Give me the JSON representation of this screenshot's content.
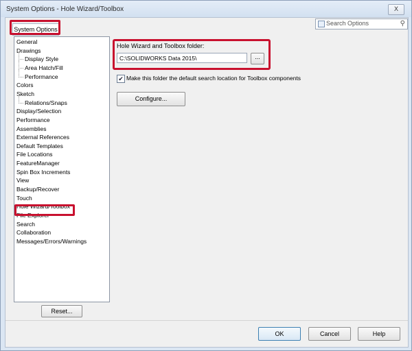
{
  "window": {
    "title": "System Options - Hole Wizard/Toolbox",
    "close_label": "X"
  },
  "tab": {
    "label": "System Options"
  },
  "search": {
    "placeholder": "Search Options"
  },
  "tree": {
    "items": [
      {
        "label": "General",
        "indent": 0
      },
      {
        "label": "Drawings",
        "indent": 0
      },
      {
        "label": "Display Style",
        "indent": 1
      },
      {
        "label": "Area Hatch/Fill",
        "indent": 1
      },
      {
        "label": "Performance",
        "indent": 1
      },
      {
        "label": "Colors",
        "indent": 0
      },
      {
        "label": "Sketch",
        "indent": 0
      },
      {
        "label": "Relations/Snaps",
        "indent": 1
      },
      {
        "label": "Display/Selection",
        "indent": 0
      },
      {
        "label": "Performance",
        "indent": 0
      },
      {
        "label": "Assemblies",
        "indent": 0
      },
      {
        "label": "External References",
        "indent": 0
      },
      {
        "label": "Default Templates",
        "indent": 0
      },
      {
        "label": "File Locations",
        "indent": 0
      },
      {
        "label": "FeatureManager",
        "indent": 0
      },
      {
        "label": "Spin Box Increments",
        "indent": 0
      },
      {
        "label": "View",
        "indent": 0
      },
      {
        "label": "Backup/Recover",
        "indent": 0
      },
      {
        "label": "Touch",
        "indent": 0
      },
      {
        "label": "Hole Wizard/Toolbox",
        "indent": 0,
        "selected": true
      },
      {
        "label": "File Explorer",
        "indent": 0
      },
      {
        "label": "Search",
        "indent": 0
      },
      {
        "label": "Collaboration",
        "indent": 0
      },
      {
        "label": "Messages/Errors/Warnings",
        "indent": 0
      }
    ],
    "reset_label": "Reset..."
  },
  "panel": {
    "folder_label": "Hole Wizard and Toolbox folder:",
    "folder_value": "C:\\SOLIDWORKS Data 2015\\",
    "browse_label": "...",
    "default_search_checked": true,
    "default_search_label": "Make this folder the default search location for Toolbox components",
    "configure_label": "Configure..."
  },
  "footer": {
    "ok_label": "OK",
    "cancel_label": "Cancel",
    "help_label": "Help"
  },
  "colors": {
    "highlight": "#c8102e"
  }
}
